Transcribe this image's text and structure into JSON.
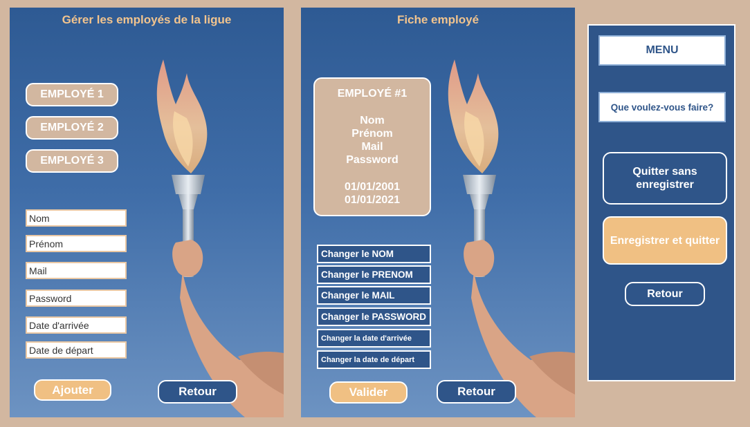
{
  "left_panel": {
    "title": "Gérer les employés de la ligue",
    "employees": [
      "EMPLOYÉ 1",
      "EMPLOYÉ 2",
      "EMPLOYÉ 3"
    ],
    "fields": {
      "nom": "Nom",
      "prenom": "Prénom",
      "mail": "Mail",
      "password": "Password",
      "date_arrivee": "Date d'arrivée",
      "date_depart": "Date de départ"
    },
    "add_label": "Ajouter",
    "back_label": "Retour"
  },
  "middle_panel": {
    "title": "Fiche employé",
    "card": {
      "title": "EMPLOYÉ #1",
      "nom": "Nom",
      "prenom": "Prénom",
      "mail": "Mail",
      "password": "Password",
      "date_arrivee": "01/01/2001",
      "date_depart": "01/01/2021"
    },
    "actions": {
      "nom": "Changer le NOM",
      "prenom": "Changer le PRENOM",
      "mail": "Changer le MAIL",
      "password": "Changer le PASSWORD",
      "date_arrivee": "Changer la date d'arrivée",
      "date_depart": "Changer la date de départ"
    },
    "validate_label": "Valider",
    "back_label": "Retour"
  },
  "menu": {
    "title": "MENU",
    "prompt": "Que voulez-vous faire?",
    "quit_label": "Quitter sans enregistrer",
    "save_quit_label": "Enregistrer et quitter",
    "back_label": "Retour"
  },
  "colors": {
    "background": "#d2b7a0",
    "panel_blue": "#2f5589",
    "accent": "#f0c083",
    "title": "#f2c48e"
  }
}
